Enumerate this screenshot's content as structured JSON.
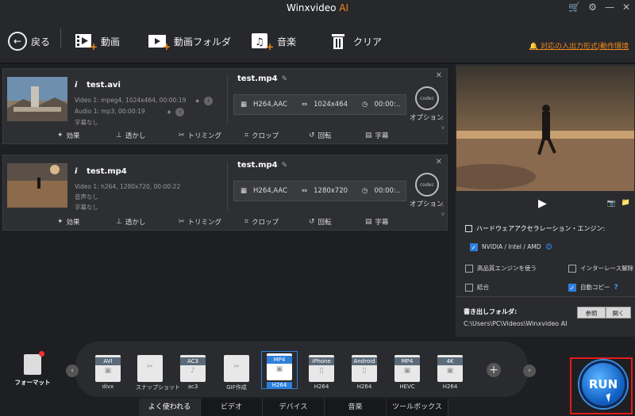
{
  "window": {
    "title_main": "Winxvideo",
    "title_ai": "AI"
  },
  "toolbar": {
    "back": "戻る",
    "video": "動画",
    "video_folder": "動画フォルダ",
    "music": "音楽",
    "clear": "クリア",
    "support_link": "対応の入出力形式|動作環境"
  },
  "items": [
    {
      "src_name": "test.avi",
      "src_video": "Video 1: mpeg4, 1024x464, 00:00:19",
      "src_audio": "Audio 1: mp3, 00:00:19",
      "src_sub": "字幕なし",
      "out_name": "test.mp4",
      "out_codec": "H264,AAC",
      "out_res": "1024x464",
      "out_time": "00:00:..",
      "codec_label": "codec",
      "option_label": "オプション"
    },
    {
      "src_name": "test.mp4",
      "src_video": "Video 1: h264, 1280x720, 00:00:22",
      "src_audio": "音声なし",
      "src_sub": "字幕なし",
      "out_name": "test.mp4",
      "out_codec": "H264,AAC",
      "out_res": "1280x720",
      "out_time": "00:00:..",
      "codec_label": "codec",
      "option_label": "オプション"
    }
  ],
  "edit_tools": {
    "effect": "効果",
    "watermark": "透かし",
    "trim": "トリミング",
    "crop": "クロップ",
    "rotate": "回転",
    "subtitle": "字幕"
  },
  "right_panel": {
    "hw_title": "ハードウェアアクセラレーション・エンジン:",
    "hw_option": "NVIDIA / Intel / AMD",
    "hq_engine": "高品質エンジンを使う",
    "deinterlace": "インターレース解除",
    "merge": "結合",
    "auto_copy": "自動コピー",
    "auto_copy_help": "?",
    "output_folder_label": "書き出しフォルダ:",
    "output_path": "C:\\Users\\PC\\Videos\\Winxvideo AI",
    "browse": "参照",
    "open": "開く"
  },
  "bottom": {
    "format_label": "フォーマット",
    "formats": [
      {
        "top": "AVI",
        "bottom": "divx"
      },
      {
        "top": "",
        "bottom": "スナップショット"
      },
      {
        "top": "AC3",
        "bottom": "ac3"
      },
      {
        "top": "",
        "bottom": "GIF作成"
      },
      {
        "top": "MP4",
        "bottom": "H264"
      },
      {
        "top": "iPhone",
        "bottom": "H264"
      },
      {
        "top": "Android",
        "bottom": "H264"
      },
      {
        "top": "MP4",
        "bottom": "HEVC"
      },
      {
        "top": "4K",
        "bottom": "H264"
      }
    ],
    "tabs": [
      "よく使われる",
      "ビデオ",
      "デバイス",
      "音楽",
      "ツールボックス"
    ],
    "run": "RUN"
  },
  "colors": {
    "accent_orange": "#f08a1c",
    "accent_blue": "#2d7fdc",
    "run_border": "#e31c1c"
  }
}
